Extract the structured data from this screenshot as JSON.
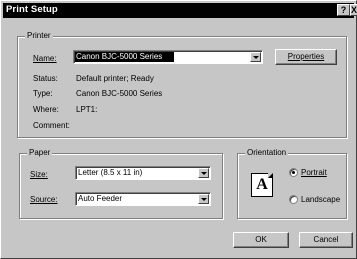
{
  "window": {
    "title": "Print Setup",
    "help_glyph": "?",
    "close_glyph": "X"
  },
  "printer": {
    "group_title": "Printer",
    "name_label": "Name:",
    "name_value": "Canon BJC-5000 Series",
    "properties_label": "Properties",
    "status_label": "Status:",
    "status_value": "Default printer; Ready",
    "type_label": "Type:",
    "type_value": "Canon BJC-5000 Series",
    "where_label": "Where:",
    "where_value": "LPT1:",
    "comment_label": "Comment:",
    "comment_value": ""
  },
  "paper": {
    "group_title": "Paper",
    "size_label": "Size:",
    "size_value": "Letter (8.5 x 11 in)",
    "source_label": "Source:",
    "source_value": "Auto Feeder"
  },
  "orientation": {
    "group_title": "Orientation",
    "icon_letter": "A",
    "portrait_label": "Portrait",
    "landscape_label": "Landscape",
    "selected": "Portrait"
  },
  "buttons": {
    "ok_label": "OK",
    "cancel_label": "Cancel"
  }
}
